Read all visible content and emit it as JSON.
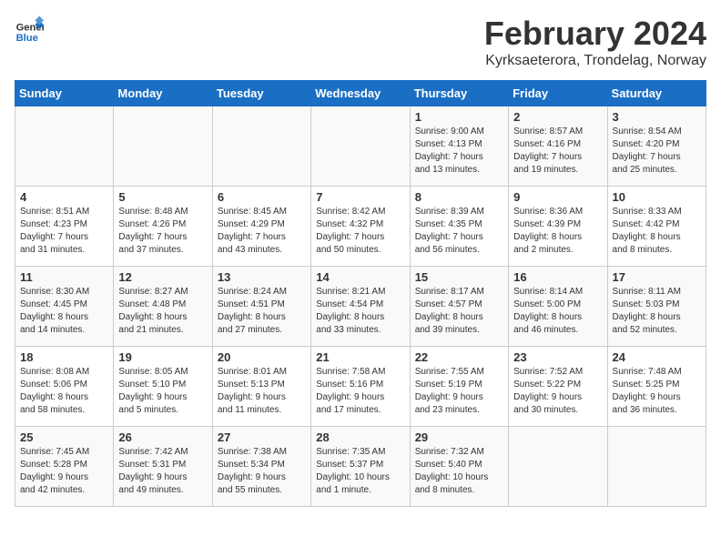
{
  "header": {
    "logo_line1": "General",
    "logo_line2": "Blue",
    "month": "February 2024",
    "location": "Kyrksaeterora, Trondelag, Norway"
  },
  "days_of_week": [
    "Sunday",
    "Monday",
    "Tuesday",
    "Wednesday",
    "Thursday",
    "Friday",
    "Saturday"
  ],
  "weeks": [
    [
      {
        "day": "",
        "info": ""
      },
      {
        "day": "",
        "info": ""
      },
      {
        "day": "",
        "info": ""
      },
      {
        "day": "",
        "info": ""
      },
      {
        "day": "1",
        "info": "Sunrise: 9:00 AM\nSunset: 4:13 PM\nDaylight: 7 hours\nand 13 minutes."
      },
      {
        "day": "2",
        "info": "Sunrise: 8:57 AM\nSunset: 4:16 PM\nDaylight: 7 hours\nand 19 minutes."
      },
      {
        "day": "3",
        "info": "Sunrise: 8:54 AM\nSunset: 4:20 PM\nDaylight: 7 hours\nand 25 minutes."
      }
    ],
    [
      {
        "day": "4",
        "info": "Sunrise: 8:51 AM\nSunset: 4:23 PM\nDaylight: 7 hours\nand 31 minutes."
      },
      {
        "day": "5",
        "info": "Sunrise: 8:48 AM\nSunset: 4:26 PM\nDaylight: 7 hours\nand 37 minutes."
      },
      {
        "day": "6",
        "info": "Sunrise: 8:45 AM\nSunset: 4:29 PM\nDaylight: 7 hours\nand 43 minutes."
      },
      {
        "day": "7",
        "info": "Sunrise: 8:42 AM\nSunset: 4:32 PM\nDaylight: 7 hours\nand 50 minutes."
      },
      {
        "day": "8",
        "info": "Sunrise: 8:39 AM\nSunset: 4:35 PM\nDaylight: 7 hours\nand 56 minutes."
      },
      {
        "day": "9",
        "info": "Sunrise: 8:36 AM\nSunset: 4:39 PM\nDaylight: 8 hours\nand 2 minutes."
      },
      {
        "day": "10",
        "info": "Sunrise: 8:33 AM\nSunset: 4:42 PM\nDaylight: 8 hours\nand 8 minutes."
      }
    ],
    [
      {
        "day": "11",
        "info": "Sunrise: 8:30 AM\nSunset: 4:45 PM\nDaylight: 8 hours\nand 14 minutes."
      },
      {
        "day": "12",
        "info": "Sunrise: 8:27 AM\nSunset: 4:48 PM\nDaylight: 8 hours\nand 21 minutes."
      },
      {
        "day": "13",
        "info": "Sunrise: 8:24 AM\nSunset: 4:51 PM\nDaylight: 8 hours\nand 27 minutes."
      },
      {
        "day": "14",
        "info": "Sunrise: 8:21 AM\nSunset: 4:54 PM\nDaylight: 8 hours\nand 33 minutes."
      },
      {
        "day": "15",
        "info": "Sunrise: 8:17 AM\nSunset: 4:57 PM\nDaylight: 8 hours\nand 39 minutes."
      },
      {
        "day": "16",
        "info": "Sunrise: 8:14 AM\nSunset: 5:00 PM\nDaylight: 8 hours\nand 46 minutes."
      },
      {
        "day": "17",
        "info": "Sunrise: 8:11 AM\nSunset: 5:03 PM\nDaylight: 8 hours\nand 52 minutes."
      }
    ],
    [
      {
        "day": "18",
        "info": "Sunrise: 8:08 AM\nSunset: 5:06 PM\nDaylight: 8 hours\nand 58 minutes."
      },
      {
        "day": "19",
        "info": "Sunrise: 8:05 AM\nSunset: 5:10 PM\nDaylight: 9 hours\nand 5 minutes."
      },
      {
        "day": "20",
        "info": "Sunrise: 8:01 AM\nSunset: 5:13 PM\nDaylight: 9 hours\nand 11 minutes."
      },
      {
        "day": "21",
        "info": "Sunrise: 7:58 AM\nSunset: 5:16 PM\nDaylight: 9 hours\nand 17 minutes."
      },
      {
        "day": "22",
        "info": "Sunrise: 7:55 AM\nSunset: 5:19 PM\nDaylight: 9 hours\nand 23 minutes."
      },
      {
        "day": "23",
        "info": "Sunrise: 7:52 AM\nSunset: 5:22 PM\nDaylight: 9 hours\nand 30 minutes."
      },
      {
        "day": "24",
        "info": "Sunrise: 7:48 AM\nSunset: 5:25 PM\nDaylight: 9 hours\nand 36 minutes."
      }
    ],
    [
      {
        "day": "25",
        "info": "Sunrise: 7:45 AM\nSunset: 5:28 PM\nDaylight: 9 hours\nand 42 minutes."
      },
      {
        "day": "26",
        "info": "Sunrise: 7:42 AM\nSunset: 5:31 PM\nDaylight: 9 hours\nand 49 minutes."
      },
      {
        "day": "27",
        "info": "Sunrise: 7:38 AM\nSunset: 5:34 PM\nDaylight: 9 hours\nand 55 minutes."
      },
      {
        "day": "28",
        "info": "Sunrise: 7:35 AM\nSunset: 5:37 PM\nDaylight: 10 hours\nand 1 minute."
      },
      {
        "day": "29",
        "info": "Sunrise: 7:32 AM\nSunset: 5:40 PM\nDaylight: 10 hours\nand 8 minutes."
      },
      {
        "day": "",
        "info": ""
      },
      {
        "day": "",
        "info": ""
      }
    ]
  ]
}
